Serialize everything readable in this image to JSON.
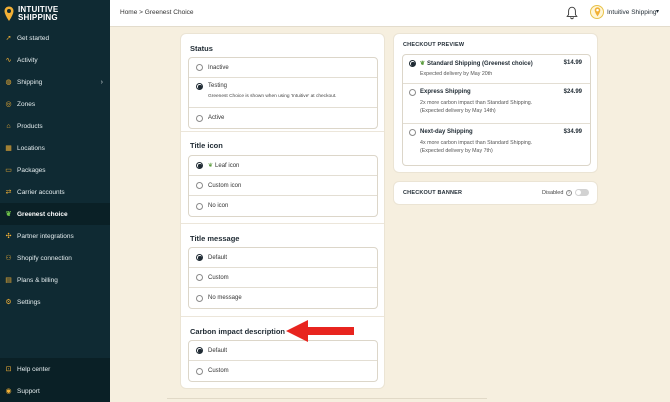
{
  "brand": {
    "line1": "INTUITIVE",
    "line2": "SHIPPING"
  },
  "sidebar": {
    "items": [
      {
        "label": "Get started",
        "icon": "rocket-icon"
      },
      {
        "label": "Activity",
        "icon": "activity-icon"
      },
      {
        "label": "Shipping",
        "icon": "globe-icon",
        "chevron": "›"
      },
      {
        "label": "Zones",
        "icon": "zones-icon"
      },
      {
        "label": "Products",
        "icon": "tag-icon"
      },
      {
        "label": "Locations",
        "icon": "location-icon"
      },
      {
        "label": "Packages",
        "icon": "package-icon"
      },
      {
        "label": "Carrier accounts",
        "icon": "truck-icon"
      },
      {
        "label": "Greenest choice",
        "icon": "leaf-icon"
      },
      {
        "label": "Partner integrations",
        "icon": "puzzle-icon"
      },
      {
        "label": "Shopify connection",
        "icon": "shop-icon"
      },
      {
        "label": "Plans & billing",
        "icon": "credit-card-icon"
      },
      {
        "label": "Settings",
        "icon": "gear-icon"
      }
    ],
    "bottom": [
      {
        "label": "Help center",
        "icon": "help-icon"
      },
      {
        "label": "Support",
        "icon": "support-icon"
      }
    ],
    "active_index": 8
  },
  "topbar": {
    "breadcrumb": "Home > Greenest Choice",
    "account_name": "Intuitive Shipping",
    "caret": "▾"
  },
  "status": {
    "title": "Status",
    "options": [
      {
        "label": "Inactive"
      },
      {
        "label": "Testing",
        "note": "Greenest Choice is shown when using 'Intuitive' at checkout."
      },
      {
        "label": "Active"
      }
    ],
    "selected": 1
  },
  "title_icon": {
    "title": "Title icon",
    "options": [
      {
        "label": "Leaf icon"
      },
      {
        "label": "Custom icon"
      },
      {
        "label": "No icon"
      }
    ],
    "selected": 0
  },
  "title_message": {
    "title": "Title message",
    "options": [
      {
        "label": "Default"
      },
      {
        "label": "Custom"
      },
      {
        "label": "No message"
      }
    ],
    "selected": 0
  },
  "carbon": {
    "title": "Carbon impact description",
    "options": [
      {
        "label": "Default"
      },
      {
        "label": "Custom"
      }
    ],
    "selected": 0
  },
  "checkout_preview": {
    "title": "CHECKOUT PREVIEW",
    "options": [
      {
        "name": "Standard Shipping (Greenest choice)",
        "price": "$14.99",
        "desc1": "Expected delivery by May 20th",
        "desc2": ""
      },
      {
        "name": "Express Shipping",
        "price": "$24.99",
        "desc1": "2x more carbon impact than Standard Shipping.",
        "desc2": "(Expected delivery by May 14th)"
      },
      {
        "name": "Next-day Shipping",
        "price": "$34.99",
        "desc1": "4x more carbon impact than Standard Shipping.",
        "desc2": "(Expected delivery by May 7th)"
      }
    ],
    "selected": 0
  },
  "checkout_banner": {
    "title": "CHECKOUT BANNER",
    "status": "Disabled",
    "help_glyph": "?"
  },
  "colors": {
    "sidebar": "#0f2a33",
    "accent": "#f2b035",
    "arrow": "#e8241f",
    "leaf": "#5a9b3c"
  }
}
